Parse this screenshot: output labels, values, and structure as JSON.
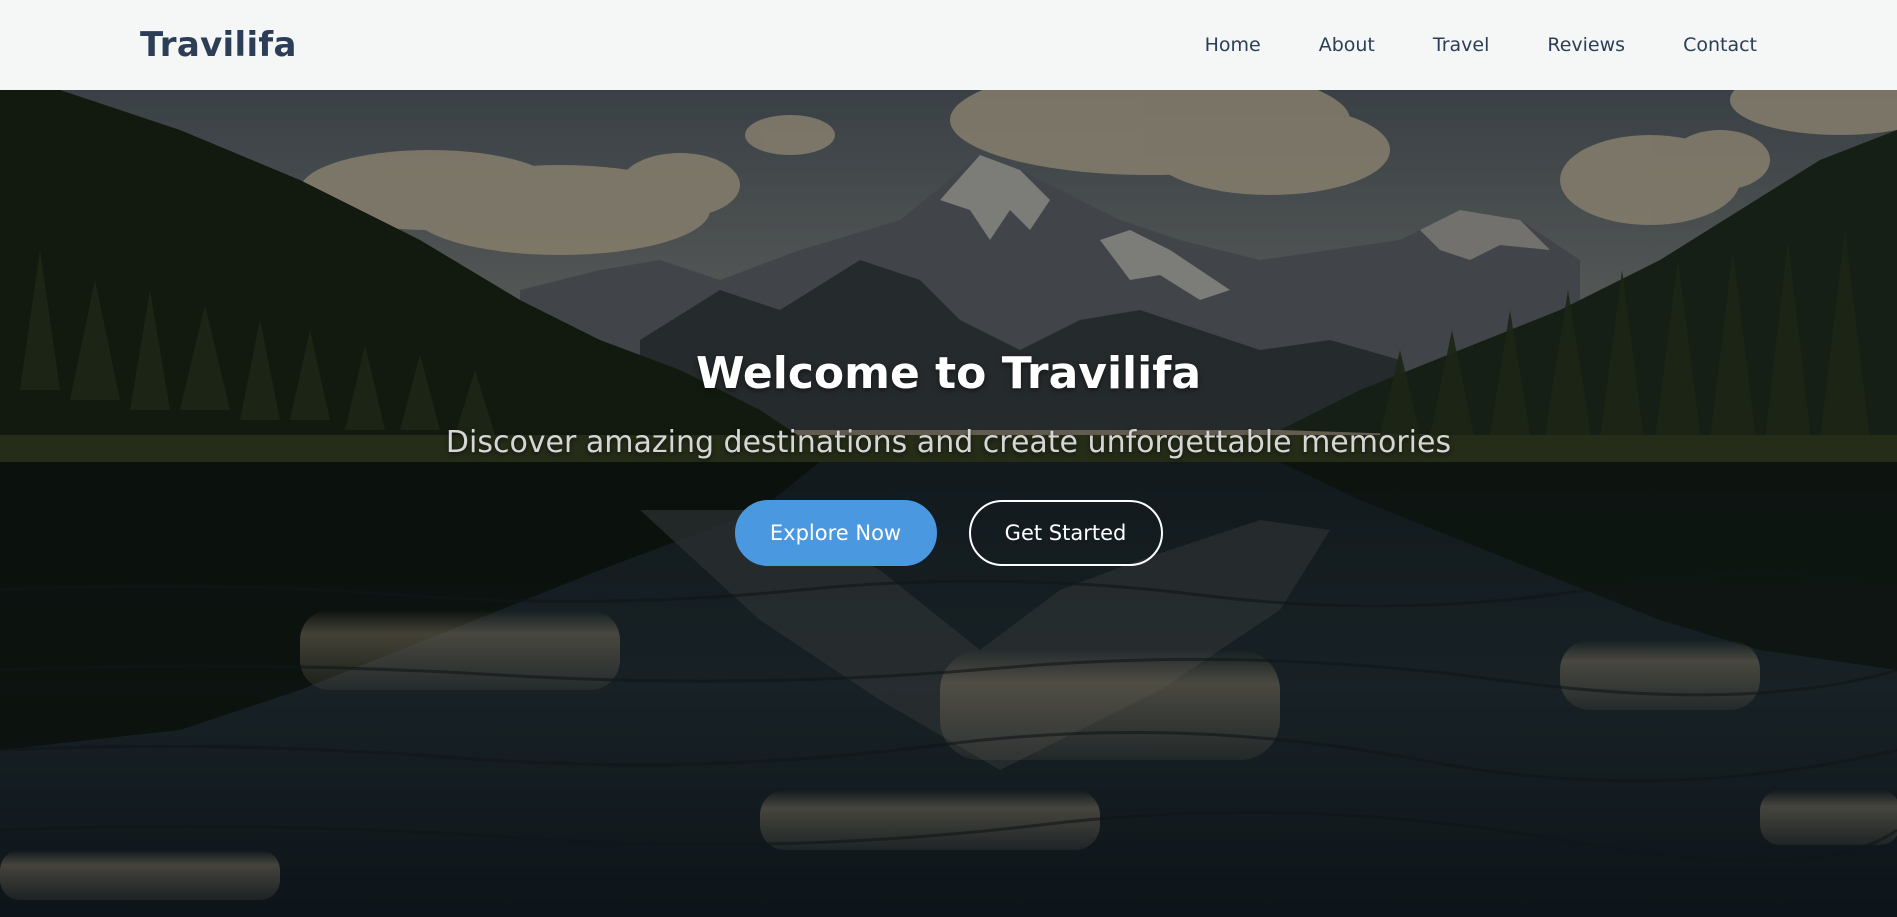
{
  "brand": {
    "name": "Travilifa"
  },
  "nav": {
    "items": [
      {
        "label": "Home"
      },
      {
        "label": "About"
      },
      {
        "label": "Travel"
      },
      {
        "label": "Reviews"
      },
      {
        "label": "Contact"
      }
    ]
  },
  "hero": {
    "title": "Welcome to Travilifa",
    "subtitle": "Discover amazing destinations and create unforgettable memories",
    "primary_button": "Explore Now",
    "secondary_button": "Get Started",
    "image_subject": "mountain-lake-landscape"
  },
  "colors": {
    "nav_background": "#f5f6f6",
    "nav_text": "#2c3e55",
    "primary_button": "#4a98df",
    "hero_text": "#ffffff"
  }
}
